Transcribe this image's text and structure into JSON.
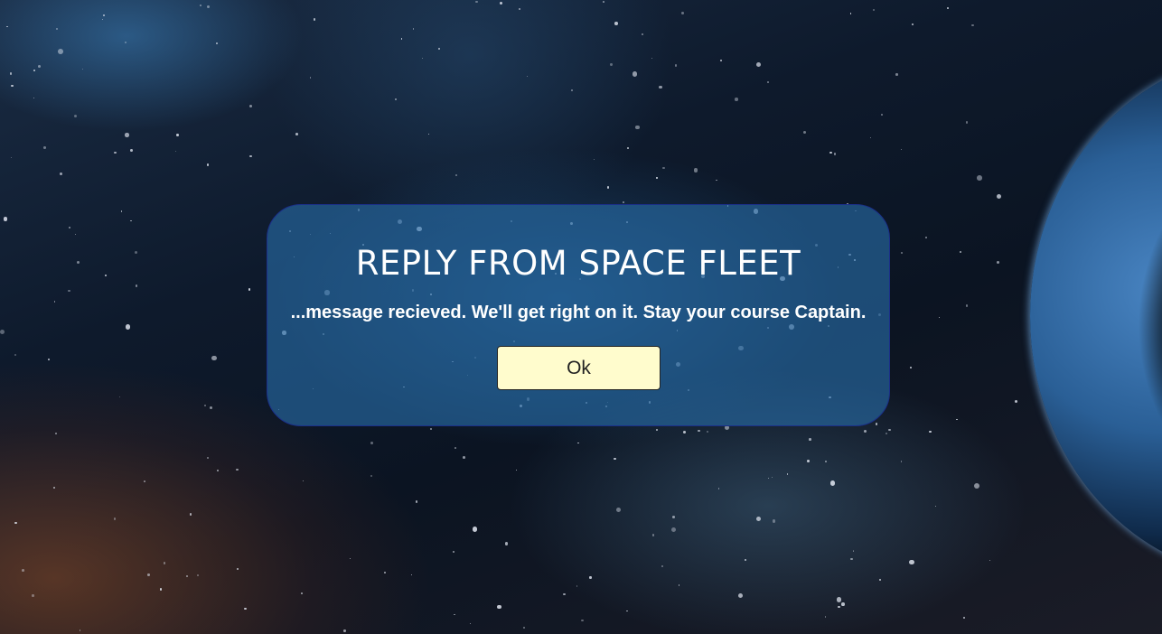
{
  "dialog": {
    "title": "REPLY FROM SPACE FLEET",
    "message": "...message recieved. We'll get right on it. Stay your course Captain.",
    "ok_label": "Ok"
  }
}
